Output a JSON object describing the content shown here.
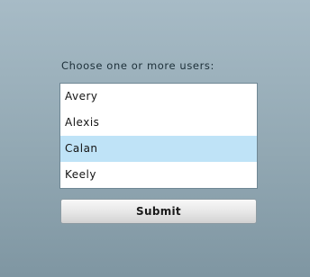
{
  "form": {
    "prompt": "Choose one or more users:",
    "users": [
      {
        "label": "Avery",
        "selected": false
      },
      {
        "label": "Alexis",
        "selected": false
      },
      {
        "label": "Calan",
        "selected": true
      },
      {
        "label": "Keely",
        "selected": false
      }
    ],
    "submit_label": "Submit"
  },
  "colors": {
    "background_top": "#a7bbc6",
    "background_bottom": "#7f96a2",
    "selection": "#bfe3f7"
  }
}
